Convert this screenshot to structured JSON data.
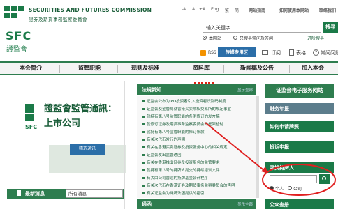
{
  "header": {
    "title_en": "SECURITIES AND FUTURES COMMISSION",
    "title_cn": "證券及期貨事務監察委員會",
    "logo_abbr": "SFC",
    "logo_cn": "證監會"
  },
  "toplinks": {
    "font_small": "-A",
    "font_mid": "A",
    "font_large": "+A",
    "lang_en": "Eng",
    "lang_tc": "繁",
    "lang_sc": "简",
    "sitemap": "网站指南",
    "my_account": "如何使用本网站",
    "contact": "联络我们"
  },
  "search": {
    "placeholder": "输入关键字",
    "button": "搜寻",
    "opt_site": "本网站",
    "opt_faq": "只搜寻常问及答问",
    "advanced": "进阶搜寻"
  },
  "tools": {
    "rss": "RSS",
    "tools_button": "传媒专用区",
    "subscribe": "订阅",
    "forms": "表格",
    "faq": "常问问题"
  },
  "nav": {
    "items": [
      "本会简介",
      "监管职能",
      "规则及标准",
      "资料库",
      "新闻稿及公告",
      "加入本会"
    ]
  },
  "banner": {
    "title_line1": "證監會監管通訊：",
    "title_line2": "上市公司",
    "chip_label": "精选通讯"
  },
  "latest": {
    "label": "最新消息",
    "filter": "所有消息"
  },
  "policy": {
    "title": "法規新知",
    "more": "显示全部",
    "items": [
      "证监会公布为IPO投资者引入投资者识别码制度",
      "证监会及金管局就香港买卖期权交易所的规定事宜",
      "就持有第八号监管职能的条例修订的发言稿",
      "就修订证券及期货事务监察委员会的框架检讨",
      "就持有第八号监管职能的修订条款",
      "有关次代币发行的声明",
      "有关在香港买卖证券及投资服务中心的相关规定",
      "证监会发出监管通函",
      "有关在香港推出证券及投资服务的监管要求",
      "就持有第八号的持牌人提交的持续培训文件",
      "有关由公司营运的持牌基金会计程序",
      "有关次代币在香港证券及期货事务监察委员会的声明",
      "有关证监会为持牌法团提供的指引"
    ]
  },
  "notice": {
    "title": "通函",
    "more": "显示全部"
  },
  "right": {
    "eservices": "证监会电子服务网站",
    "consumer": "财务年报",
    "apply": "如何申请牌照",
    "complaint": "投诉申报",
    "licensee_search": "寻找持牌人",
    "search_btn": "搜寻",
    "opt_person": "个人",
    "opt_company": "公司",
    "public_register": "公众查册"
  }
}
